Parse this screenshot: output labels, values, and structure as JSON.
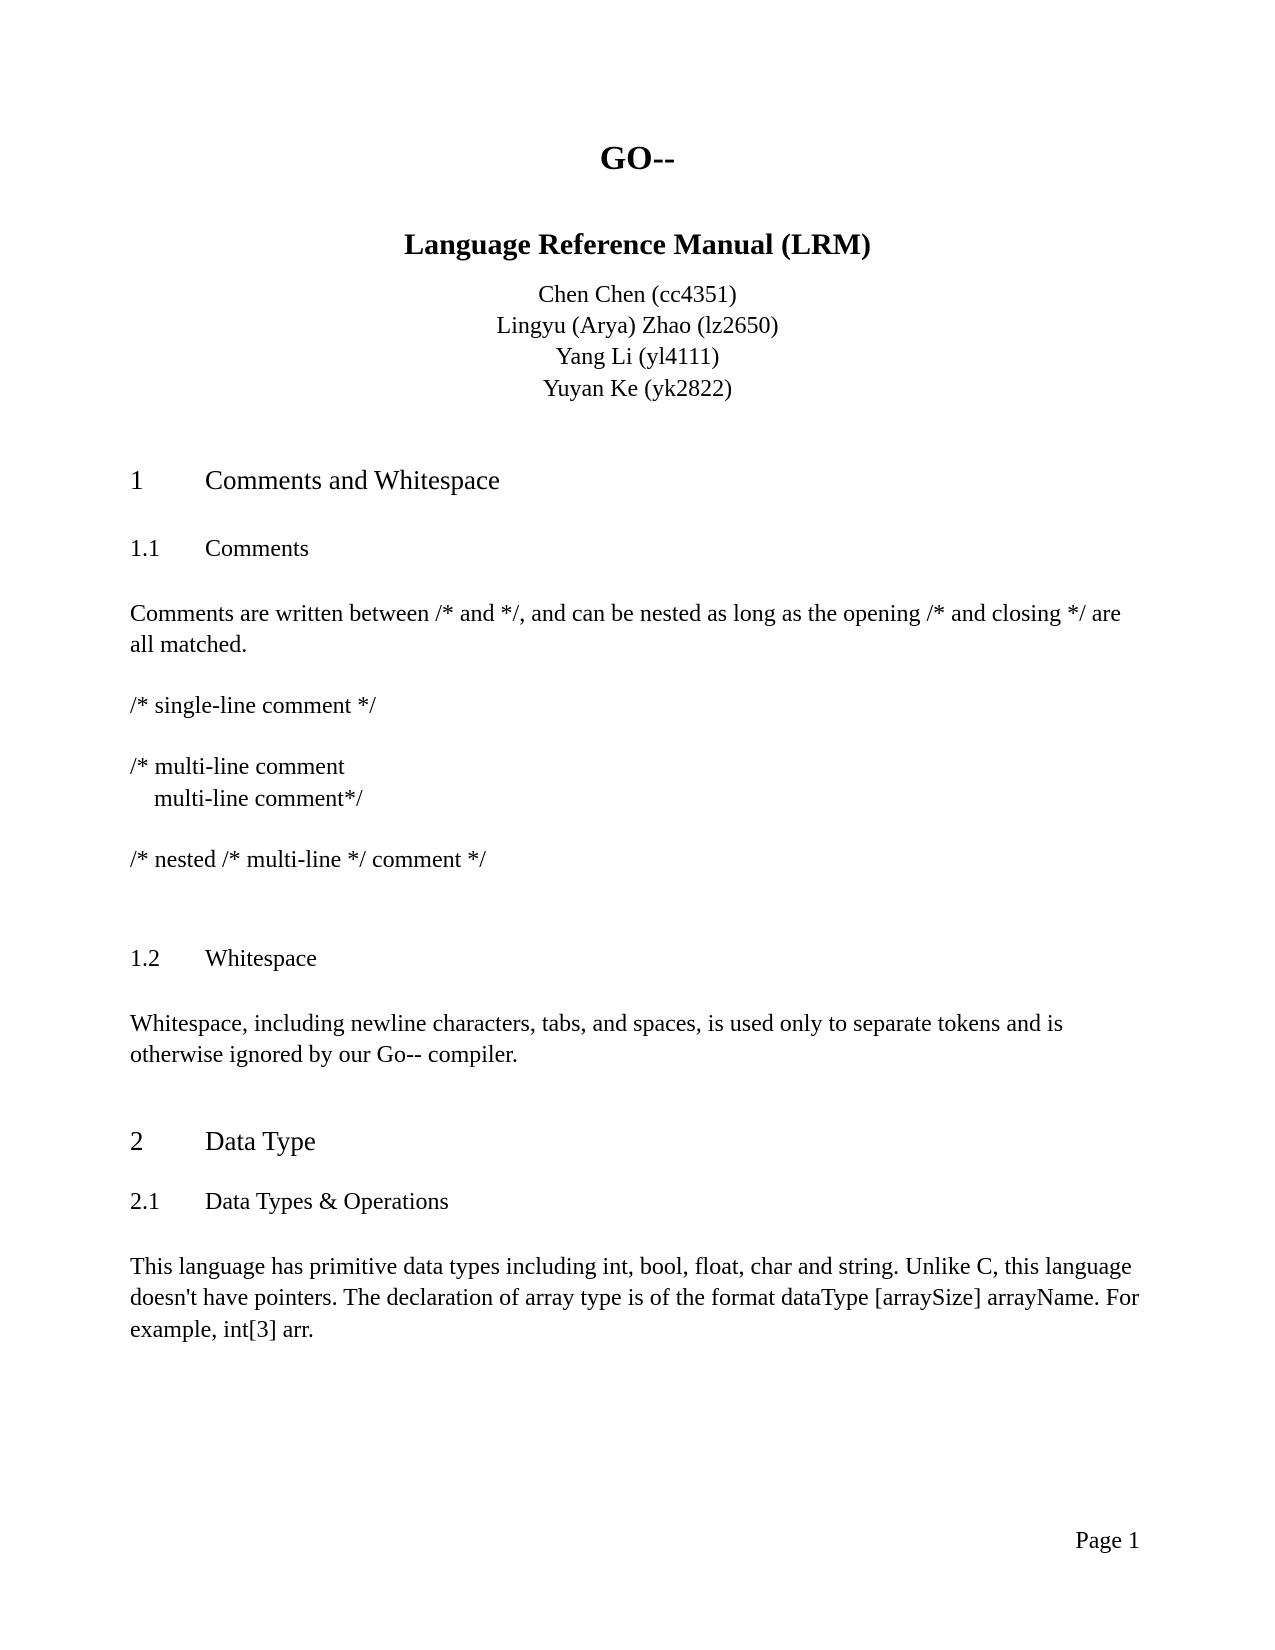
{
  "titleMain": "GO--",
  "titleSub": "Language Reference Manual (LRM)",
  "authors": [
    "Chen Chen (cc4351)",
    "Lingyu (Arya) Zhao (lz2650)",
    "Yang Li (yl4111)",
    "Yuyan Ke (yk2822)"
  ],
  "sec1": {
    "num": "1",
    "title": "Comments and Whitespace"
  },
  "sec1_1": {
    "num": "1.1",
    "title": "Comments"
  },
  "para1_1": "Comments are written between /* and */, and can be nested as long as the opening /* and closing */ are all matched.",
  "code1": "/* single-line comment */",
  "code2": "/* multi-line comment\n    multi-line comment*/",
  "code3": "/* nested /* multi-line */ comment */",
  "sec1_2": {
    "num": "1.2",
    "title": "Whitespace"
  },
  "para1_2": "Whitespace, including newline characters, tabs, and spaces, is used only to separate tokens and is otherwise ignored by our Go-- compiler.",
  "sec2": {
    "num": "2",
    "title": "Data Type"
  },
  "sec2_1": {
    "num": "2.1",
    "title": "Data Types & Operations"
  },
  "para2_1": "This language has primitive data types including int, bool, float, char and string. Unlike C, this language doesn't have pointers. The declaration of array type is of the format dataType [arraySize]  arrayName. For example, int[3] arr.",
  "pageFooter": "Page 1"
}
